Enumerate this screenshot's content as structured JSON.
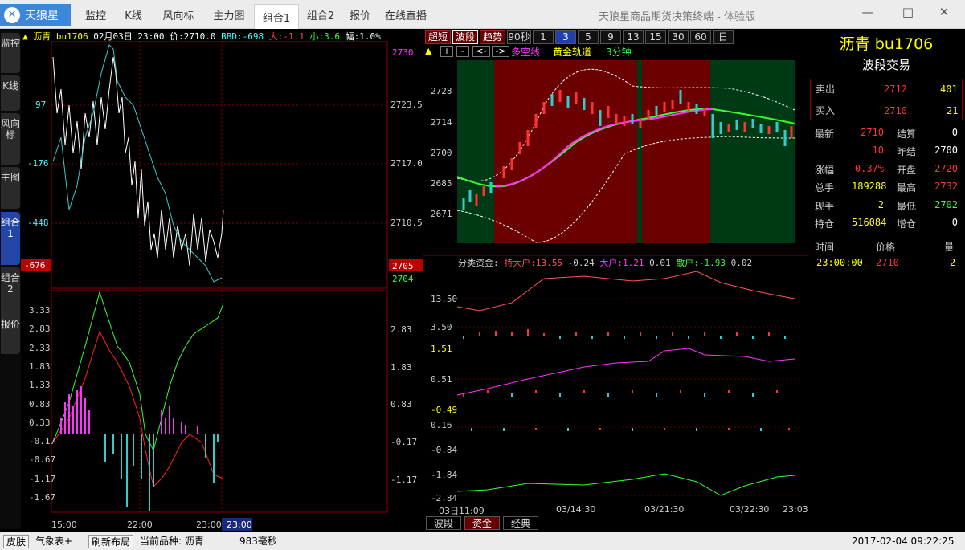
{
  "window": {
    "logo": "天狼星",
    "title": "天狼星商品期货决策终端 - 体验版",
    "min": "—",
    "max": "□",
    "close": "✕"
  },
  "menu": [
    {
      "label": "监控"
    },
    {
      "label": "K线"
    },
    {
      "label": "风向标"
    },
    {
      "label": "主力图"
    },
    {
      "label": "组合1"
    },
    {
      "label": "组合2"
    },
    {
      "label": "报价"
    },
    {
      "label": "在线直播"
    }
  ],
  "sidetabs": [
    "监控",
    "K线",
    "风向标",
    "主图",
    "组合1",
    "组合2",
    "报价"
  ],
  "left": {
    "header": {
      "name": "沥青",
      "code": "bu1706",
      "date": "02月03日",
      "time": "23:00",
      "price": "价:2710.0",
      "bbd": "BBD:-698",
      "big": "大:-1.1",
      "small": "小:3.6",
      "amp": "幅:1.0%"
    },
    "left_axis": [
      "97",
      "-176",
      "-448",
      "-676"
    ],
    "right_axis": [
      "2730",
      "2723.5",
      "2717.0",
      "2710.5",
      "2705",
      "2704"
    ],
    "osc_left": [
      "3.33",
      "2.83",
      "2.33",
      "1.83",
      "1.33",
      "0.83",
      "0.33",
      "-0.17",
      "-0.67",
      "-1.17",
      "-1.67"
    ],
    "osc_right": [
      "2.83",
      "1.83",
      "0.83",
      "-0.17",
      "-1.17"
    ],
    "time_axis": [
      "15:00",
      "22:00",
      "23:00",
      "23:00"
    ]
  },
  "mid": {
    "buttons": [
      "超短",
      "波段",
      "趋势",
      "90秒",
      "1",
      "3",
      "5",
      "9",
      "13",
      "15",
      "30",
      "60",
      "日"
    ],
    "tools": [
      "▲",
      "+",
      "-",
      "<-",
      "->"
    ],
    "labels": {
      "dkx": "多空线",
      "gold": "黄金轨道",
      "period": "3分钟"
    },
    "price_axis": [
      "2728",
      "2714",
      "2700",
      "2685",
      "2671"
    ],
    "fund": {
      "title": "分类资金:",
      "t1": "特大户:13.55",
      "v1": "-0.24",
      "t2": "大户:1.21",
      "v2": "0.01",
      "t3": "散户:-1.93",
      "v3": "0.02"
    },
    "fund_axis": [
      "13.50",
      "3.50",
      "1.51",
      "0.51",
      "-0.49",
      "0.16",
      "-0.84",
      "-1.84",
      "-2.84"
    ],
    "date_axis": [
      "03日11:09",
      "03/14:30",
      "03/21:30",
      "03/22:30",
      "23:03"
    ],
    "tabs": [
      "波段",
      "资金",
      "经典"
    ]
  },
  "right": {
    "name": "沥青",
    "code": "bu1706",
    "subtitle": "波段交易",
    "sell": {
      "label": "卖出",
      "price": "2712",
      "vol": "401"
    },
    "buy": {
      "label": "买入",
      "price": "2710",
      "vol": "21"
    },
    "rows": [
      {
        "l": "最新",
        "lv": "2710",
        "r": "结算",
        "rv": "0"
      },
      {
        "l": "",
        "lv": "10",
        "r": "昨结",
        "rv": "2700"
      },
      {
        "l": "涨幅",
        "lv": "0.37%",
        "r": "开盘",
        "rv": "2720"
      },
      {
        "l": "总手",
        "lv": "189288",
        "r": "最高",
        "rv": "2732"
      },
      {
        "l": "现手",
        "lv": "2",
        "r": "最低",
        "rv": "2702"
      },
      {
        "l": "持仓",
        "lv": "516084",
        "r": "增仓",
        "rv": "0"
      }
    ],
    "trades_head": [
      "时间",
      "价格",
      "量"
    ],
    "trades": [
      {
        "t": "23:00:00",
        "p": "2710",
        "v": "2"
      }
    ]
  },
  "status": {
    "skin": "皮肤",
    "weather": "气象表+",
    "refresh": "刷新布局",
    "current": "当前品种: 沥青",
    "ms": "983毫秒",
    "datetime": "2017-02-04  09:22:25"
  },
  "colors": {
    "up": "#ff3333",
    "down": "#33dddd",
    "pink": "#ff33ff",
    "green": "#33ff33",
    "gold": "#ffff00"
  }
}
